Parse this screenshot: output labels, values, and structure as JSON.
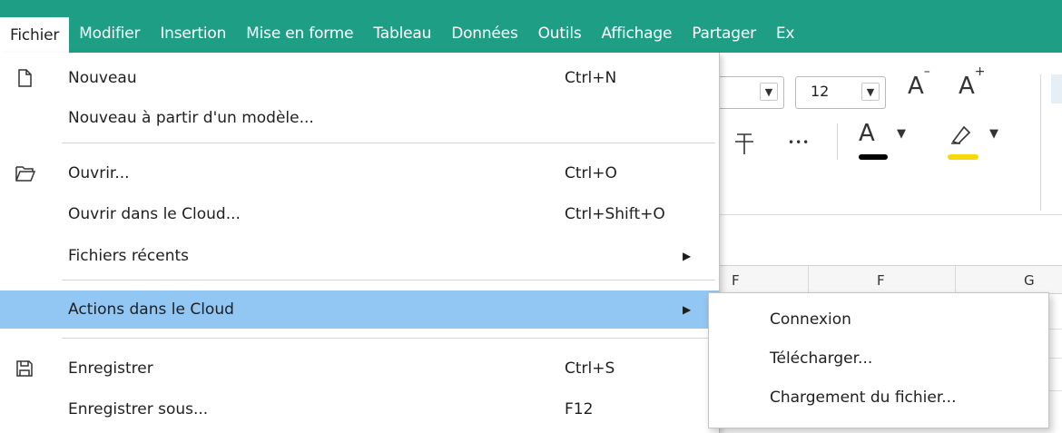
{
  "menubar": {
    "items": [
      {
        "label": "Fichier"
      },
      {
        "label": "Modifier"
      },
      {
        "label": "Insertion"
      },
      {
        "label": "Mise en forme"
      },
      {
        "label": "Tableau"
      },
      {
        "label": "Données"
      },
      {
        "label": "Outils"
      },
      {
        "label": "Affichage"
      },
      {
        "label": "Partager"
      },
      {
        "label": "Ex"
      }
    ],
    "accent": "#1e9e85"
  },
  "toolbar": {
    "font_size_value": "12",
    "shrink_font_label": "A",
    "grow_font_label": "A",
    "shrink_sup": "–",
    "grow_sup": "+",
    "more_label": "•••",
    "font_color_label": "A",
    "font_color": "#000000",
    "highlight_color": "#f5d90a",
    "column_headers": [
      "F",
      "F",
      "G"
    ]
  },
  "file_menu": {
    "items": [
      {
        "label": "Nouveau",
        "shortcut": "Ctrl+N",
        "icon": "new-file-icon"
      },
      {
        "label": "Nouveau à partir d'un modèle...",
        "shortcut": ""
      },
      {
        "label": "Ouvrir...",
        "shortcut": "Ctrl+O",
        "icon": "folder-open-icon"
      },
      {
        "label": "Ouvrir dans le Cloud...",
        "shortcut": "Ctrl+Shift+O"
      },
      {
        "label": "Fichiers récents",
        "shortcut": "",
        "submenu": true
      },
      {
        "label": "Actions dans le Cloud",
        "shortcut": "",
        "submenu": true,
        "highlighted": true
      },
      {
        "label": "Enregistrer",
        "shortcut": "Ctrl+S",
        "icon": "save-icon"
      },
      {
        "label": "Enregistrer sous...",
        "shortcut": "F12"
      }
    ],
    "highlight_color": "#92c6f3"
  },
  "cloud_submenu": {
    "items": [
      {
        "label": "Connexion"
      },
      {
        "label": "Télécharger..."
      },
      {
        "label": "Chargement du fichier..."
      }
    ]
  }
}
